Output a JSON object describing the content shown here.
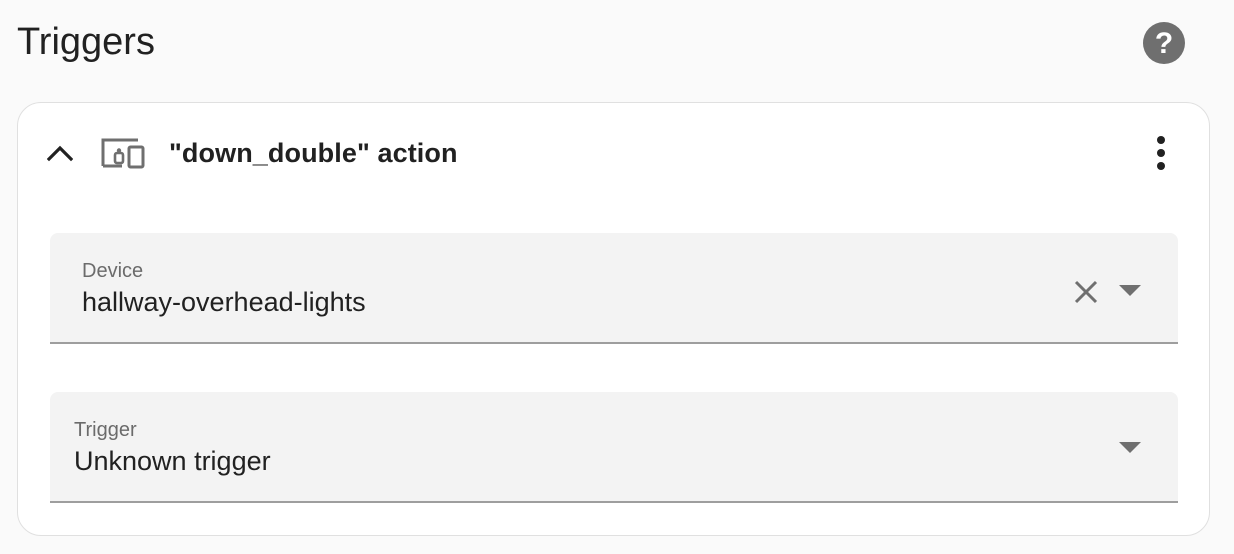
{
  "header": {
    "title": "Triggers",
    "help_icon": "help-circle-icon"
  },
  "trigger_card": {
    "title": "\"down_double\" action",
    "collapse_icon": "chevron-up-icon",
    "type_icon": "devices-icon",
    "menu_icon": "dots-vertical-icon",
    "device_field": {
      "label": "Device",
      "value": "hallway-overhead-lights",
      "clear_icon": "close-icon",
      "dropdown_icon": "menu-down-icon"
    },
    "trigger_field": {
      "label": "Trigger",
      "value": "Unknown trigger",
      "dropdown_icon": "menu-down-icon"
    }
  },
  "colors": {
    "page_background": "#fafafa",
    "card_background": "#ffffff",
    "field_background": "#f3f3f3",
    "icon_gray": "#6f6f6f",
    "text_primary": "#212121",
    "text_secondary": "#6b6b6b"
  }
}
